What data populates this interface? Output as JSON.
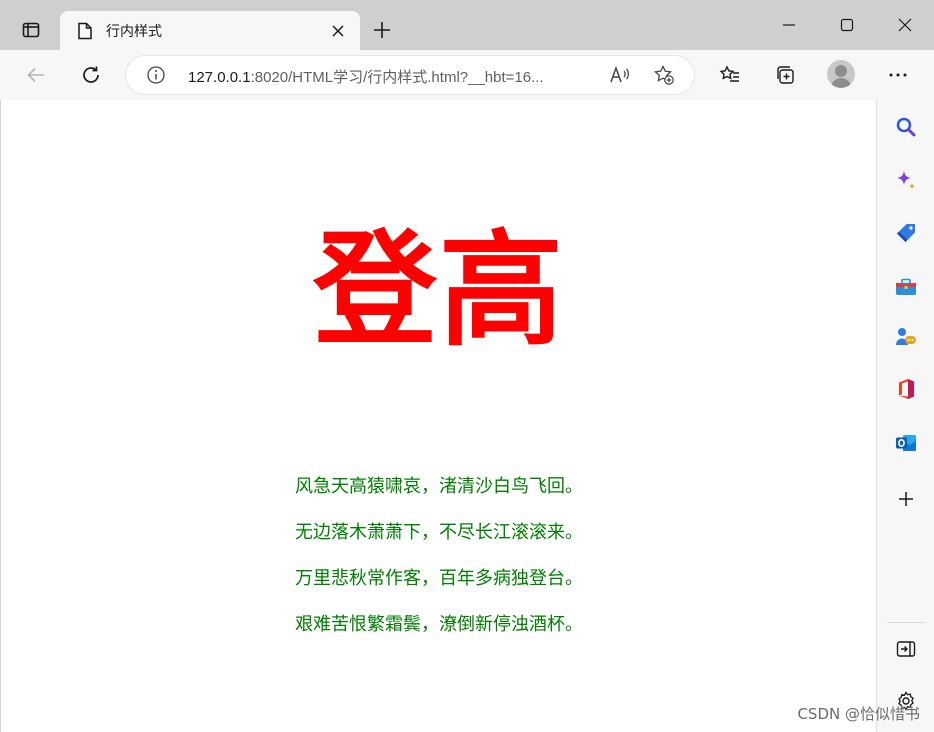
{
  "browser": {
    "tab": {
      "title": "行内样式"
    },
    "address": {
      "host": "127.0.0.1",
      "rest": ":8020/HTML学习/行内样式.html?__hbt=16..."
    }
  },
  "page": {
    "heading": "登高",
    "poem_lines": [
      "风急天高猿啸哀，渚清沙白鸟飞回。",
      "无边落木萧萧下，不尽长江滚滚来。",
      "万里悲秋常作客，百年多病独登台。",
      "艰难苦恨繁霜鬓，潦倒新停浊酒杯。"
    ]
  },
  "colors": {
    "heading": "#ff0000",
    "poem": "#008000",
    "chrome": "#cfcfcf"
  },
  "watermark": "CSDN @恰似惜书"
}
